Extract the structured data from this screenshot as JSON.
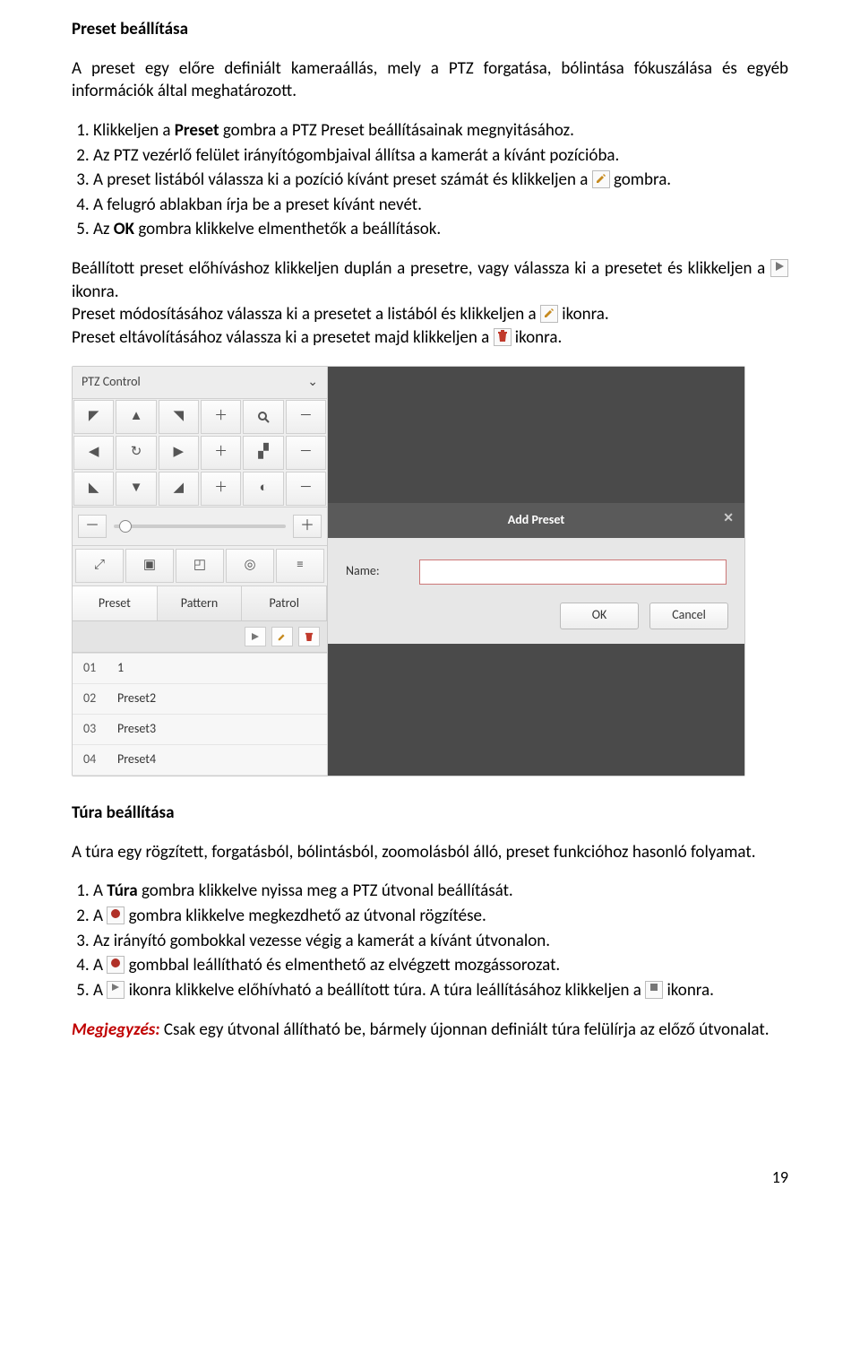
{
  "section1": {
    "title": "Preset beállítása",
    "intro": "A preset egy előre definiált kameraállás, mely a PTZ forgatása, bólintása fókuszálása és egyéb információk által meghatározott.",
    "steps": [
      {
        "pre": "Klikkeljen a ",
        "b": "Preset",
        "post": " gombra a PTZ Preset beállításainak megnyitásához."
      },
      {
        "pre": "Az PTZ vezérlő felület irányítógombjaival állítsa a kamerát a kívánt pozícióba.",
        "b": "",
        "post": ""
      },
      {
        "pre": "A preset listából válassza ki a pozíció kívánt preset számát és klikkeljen a ",
        "icon": "edit",
        "post": " gombra."
      },
      {
        "pre": "A felugró ablakban írja be a preset kívánt nevét.",
        "b": "",
        "post": ""
      },
      {
        "pre": "Az ",
        "b": "OK",
        "post": " gombra klikkelve elmenthetők a beállítások."
      }
    ],
    "para2a": "Beállított preset előhíváshoz klikkeljen duplán a presetre, vagy válassza ki a presetet és klikkeljen a ",
    "para2b": "ikonra.",
    "para3a": "Preset módosításához válassza ki a presetet a listából és klikkeljen a ",
    "para3b": " ikonra.",
    "para4a": "Preset eltávolításához válassza ki a presetet majd klikkeljen a ",
    "para4b": " ikonra."
  },
  "ptz": {
    "title": "PTZ Control",
    "tabs": [
      "Preset",
      "Pattern",
      "Patrol"
    ],
    "presets": [
      {
        "n": "01",
        "name": "1"
      },
      {
        "n": "02",
        "name": "Preset2"
      },
      {
        "n": "03",
        "name": "Preset3"
      },
      {
        "n": "04",
        "name": "Preset4"
      }
    ],
    "dialog": {
      "title": "Add Preset",
      "nameLabel": "Name:",
      "ok": "OK",
      "cancel": "Cancel"
    }
  },
  "section2": {
    "title": "Túra beállítása",
    "intro": "A túra egy rögzített, forgatásból, bólintásból, zoomolásból álló, preset funkcióhoz hasonló folyamat.",
    "steps": [
      {
        "pre": "A ",
        "b": "Túra",
        "post": " gombra klikkelve nyissa meg a PTZ útvonal beállítását."
      },
      {
        "pre": "A ",
        "icon": "rec",
        "post": " gombra klikkelve megkezdhető az útvonal rögzítése."
      },
      {
        "pre": "Az irányító gombokkal vezesse végig a kamerát a kívánt útvonalon.",
        "b": "",
        "post": ""
      },
      {
        "pre": "A ",
        "icon": "rec",
        "post": " gombbal leállítható és elmenthető az elvégzett mozgássorozat."
      },
      {
        "pre": "A ",
        "icon": "play",
        "post": " ikonra klikkelve előhívható a beállított túra. A túra leállításához klikkeljen a ",
        "icon2": "stop",
        "post2": " ikonra."
      }
    ],
    "noteLabel": "Megjegyzés:",
    "note": " Csak egy útvonal állítható be, bármely újonnan definiált túra felülírja az előző útvonalat."
  },
  "pageNumber": "19"
}
